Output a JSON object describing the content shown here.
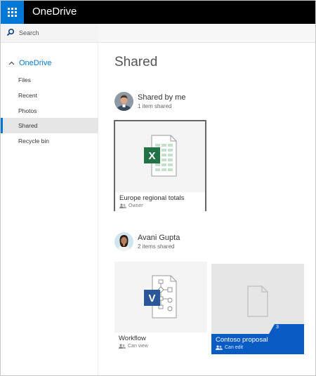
{
  "header": {
    "app_title": "OneDrive"
  },
  "search": {
    "label": "Search"
  },
  "sidebar": {
    "heading": "OneDrive",
    "items": [
      {
        "label": "Files"
      },
      {
        "label": "Recent"
      },
      {
        "label": "Photos"
      },
      {
        "label": "Shared",
        "active": true
      },
      {
        "label": "Recycle bin"
      }
    ]
  },
  "main": {
    "title": "Shared",
    "groups": [
      {
        "name": "Shared by me",
        "count": "1 item shared",
        "items": [
          {
            "name": "Europe regional totals",
            "role": "Owner",
            "icon": "excel-file-icon"
          }
        ]
      },
      {
        "name": "Avani Gupta",
        "count": "2 items shared",
        "items": [
          {
            "name": "Workflow",
            "role": "Can view",
            "icon": "visio-file-icon"
          },
          {
            "name": "Contoso proposal",
            "role": "Can edit",
            "icon": "generic-file-icon",
            "badge": "3"
          }
        ]
      }
    ]
  },
  "colors": {
    "accent": "#0078d7",
    "topbar": "#000000",
    "excel_green": "#217346",
    "visio_blue": "#2b579a",
    "selected_tile_caption": "#0a5bc4"
  }
}
